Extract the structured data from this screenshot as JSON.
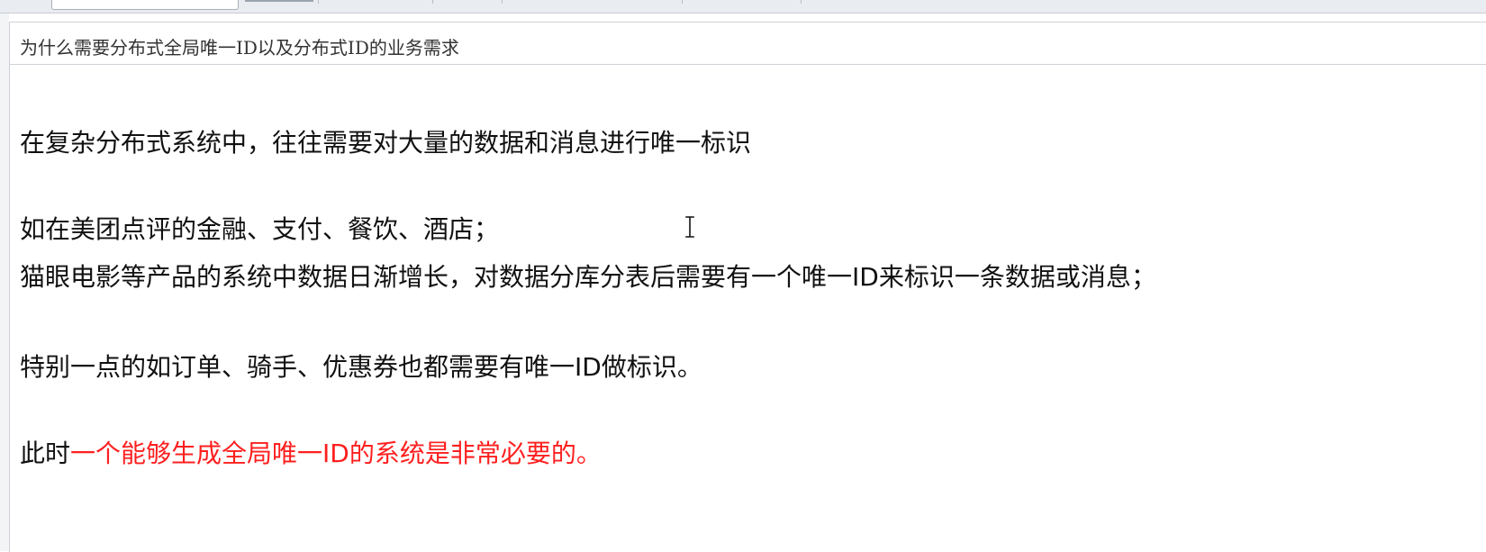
{
  "toolbar": {
    "search_input_value": ""
  },
  "document": {
    "title": "为什么需要分布式全局唯一ID以及分布式ID的业务需求",
    "paragraphs": [
      {
        "text": "在复杂分布式系统中，往往需要对大量的数据和消息进行唯一标识"
      },
      {
        "text": "如在美团点评的金融、支付、餐饮、酒店；"
      },
      {
        "text": "猫眼电影等产品的系统中数据日渐增长，对数据分库分表后需要有一个唯一ID来标识一条数据或消息；"
      },
      {
        "text": "特别一点的如订单、骑手、优惠券也都需要有唯一ID做标识。"
      },
      {
        "prefix": "此时",
        "emphasis": "一个能够生成全局唯一ID的系统是非常必要的。"
      }
    ]
  },
  "colors": {
    "emphasis": "#ff1f1f",
    "body_text": "#111111",
    "title_text": "#333333"
  },
  "icons": {
    "cursor": "text-cursor-icon"
  }
}
